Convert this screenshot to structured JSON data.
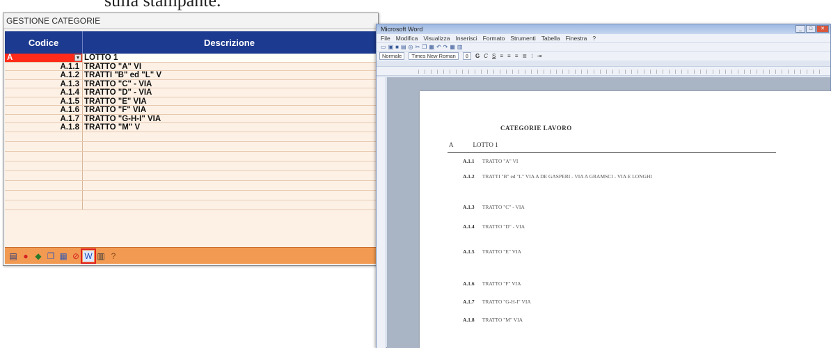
{
  "caption": "sulla stampante.",
  "left_window": {
    "title": "GESTIONE CATEGORIE",
    "columns": {
      "code": "Codice",
      "description": "Descrizione"
    },
    "first_row": {
      "code": "A",
      "description": "LOTTO 1"
    },
    "rows": [
      {
        "code": "A.1.1",
        "description": "TRATTO \"A\" VI"
      },
      {
        "code": "A.1.2",
        "description": "TRATTI \"B\" ed \"L\" V"
      },
      {
        "code": "A.1.3",
        "description": "TRATTO \"C\" - VIA"
      },
      {
        "code": "A.1.4",
        "description": "TRATTO \"D\" - VIA"
      },
      {
        "code": "A.1.5",
        "description": "TRATTO \"E\" VIA"
      },
      {
        "code": "A.1.6",
        "description": "TRATTO \"F\" VIA"
      },
      {
        "code": "A.1.7",
        "description": "TRATTO \"G-H-I\" VIA"
      },
      {
        "code": "A.1.8",
        "description": "TRATTO \"M\" V"
      }
    ],
    "empty_rows": 6,
    "toolbar_icons": [
      "print-icon",
      "delete-icon",
      "edit-icon",
      "copy-icon",
      "paste-icon",
      "cancel-icon",
      "word-export-icon",
      "printer-icon",
      "help-icon"
    ],
    "highlighted_icon": "word-export-icon"
  },
  "word_window": {
    "title": "Microsoft Word",
    "menu": [
      "File",
      "Modifica",
      "Visualizza",
      "Inserisci",
      "Formato",
      "Strumenti",
      "Tabella",
      "Finestra",
      "?"
    ],
    "style_box": "Normale",
    "font_box": "Times New Roman",
    "size_box": "8",
    "document": {
      "heading": "CATEGORIE LAVORO",
      "lotto_code": "A",
      "lotto_label": "LOTTO 1",
      "items": [
        {
          "code": "A.1.1",
          "text": "TRATTO \"A\" VI"
        },
        {
          "code": "A.1.2",
          "text": "TRATTI \"B\" ed \"L\" VIA A DE GASPERI - VIA A GRAMSCI - VIA E LONGHI"
        },
        {
          "code": "A.1.3",
          "text": "TRATTO \"C\" - VIA"
        },
        {
          "code": "A.1.4",
          "text": "TRATTO \"D\" - VIA"
        },
        {
          "code": "A.1.5",
          "text": "TRATTO \"E\" VIA"
        },
        {
          "code": "A.1.6",
          "text": "TRATTO \"F\" VIA"
        },
        {
          "code": "A.1.7",
          "text": "TRATTO \"G-H-I\" VIA"
        },
        {
          "code": "A.1.8",
          "text": "TRATTO \"M\" VIA"
        }
      ]
    }
  }
}
